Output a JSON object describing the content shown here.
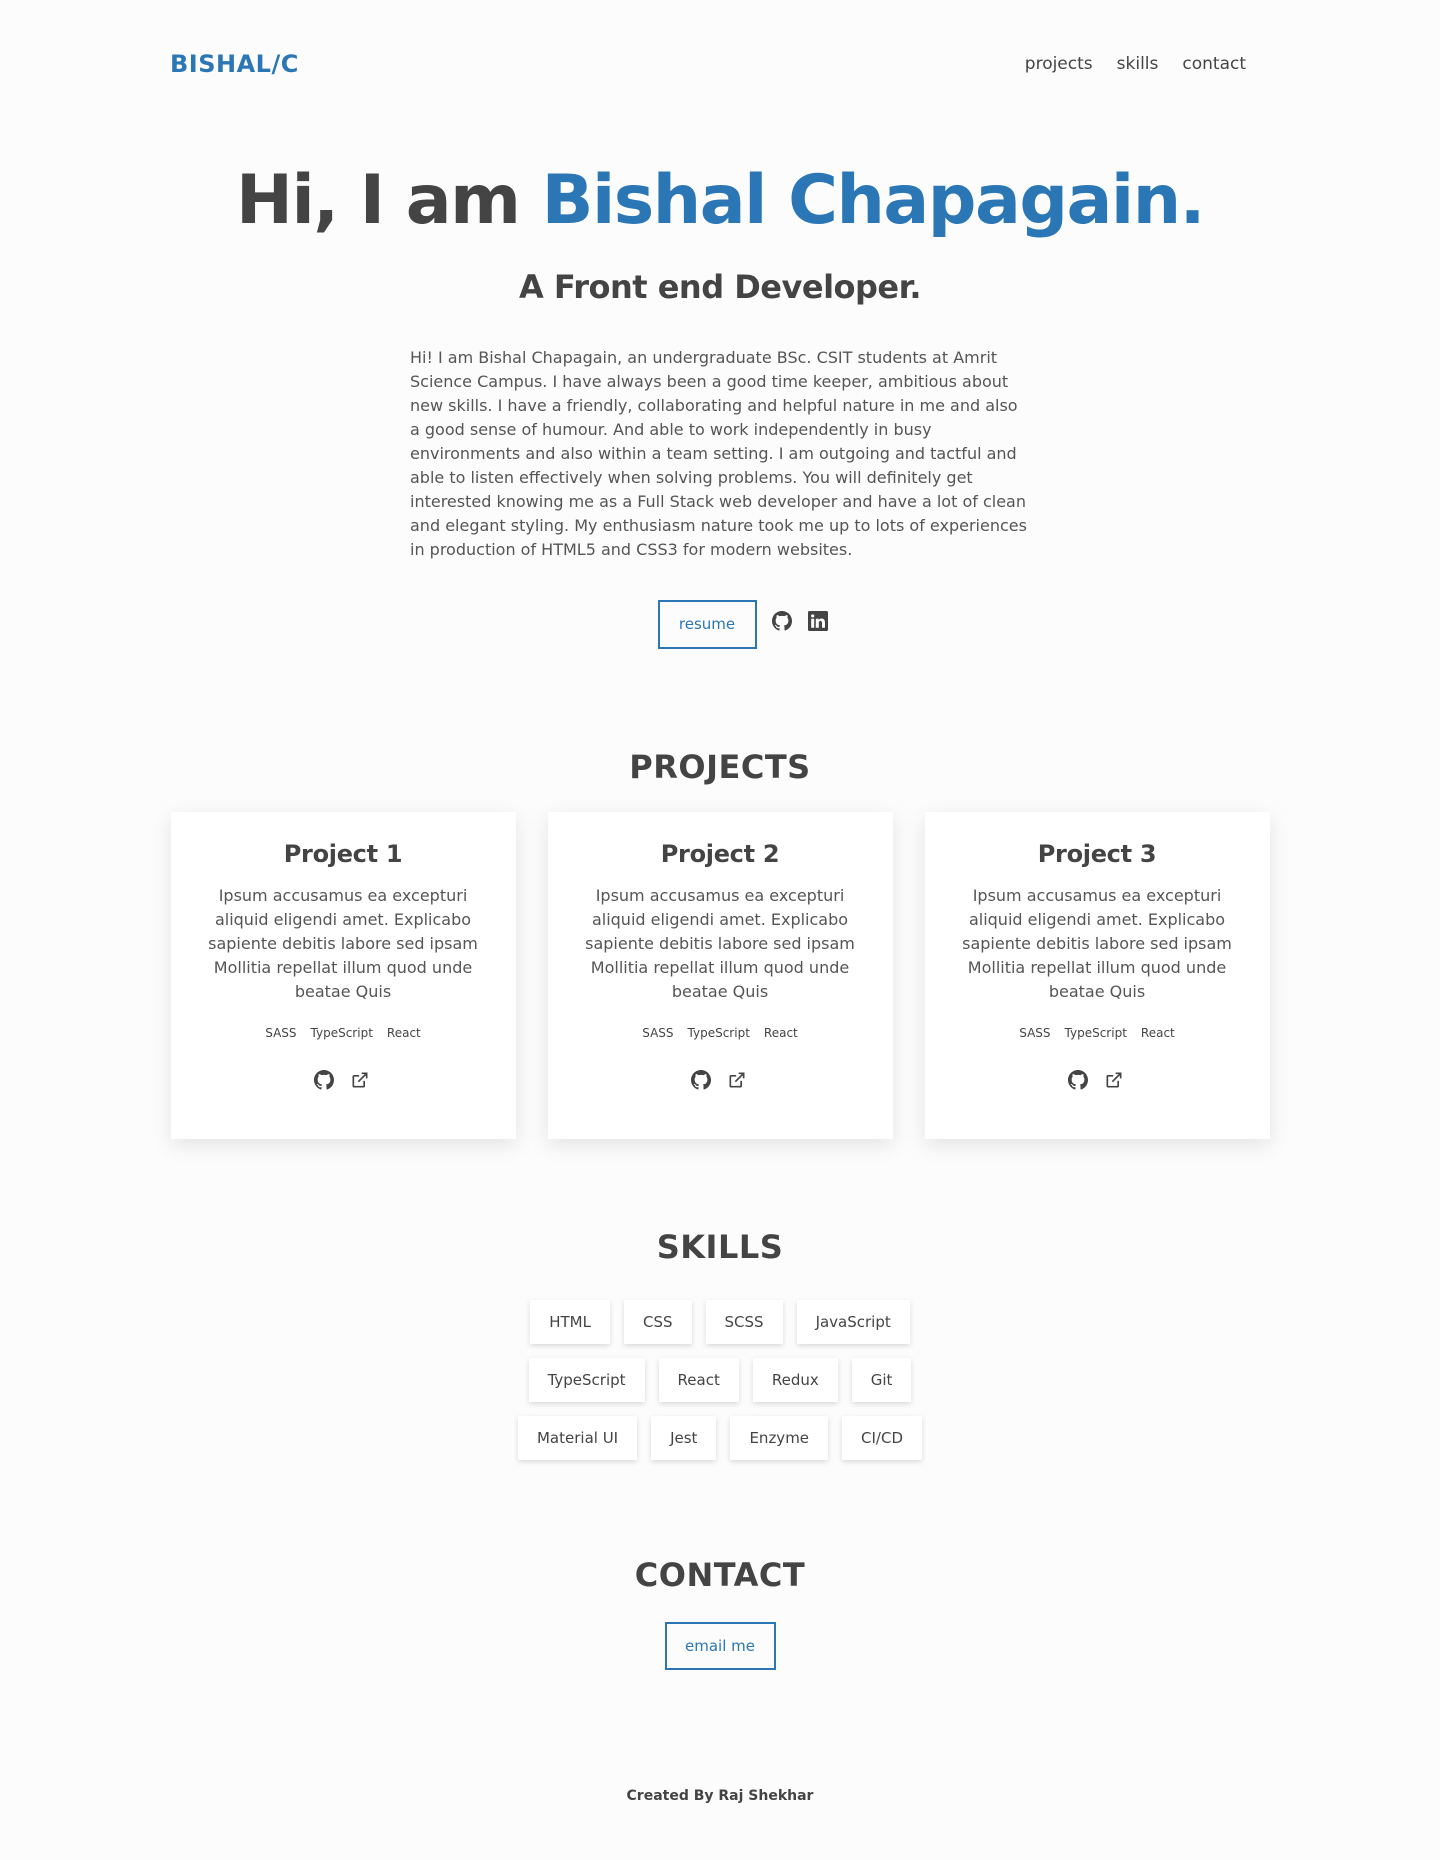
{
  "header": {
    "logo": "BISHAL/C",
    "nav": [
      "projects",
      "skills",
      "contact"
    ]
  },
  "hero": {
    "greeting": "Hi, I am ",
    "name": "Bishal Chapagain.",
    "subtitle": "A Front end Developer.",
    "about": "Hi! I am Bishal Chapagain, an undergraduate BSc. CSIT students at Amrit Science Campus. I have always been a good time keeper, ambitious about new skills. I have a friendly, collaborating and helpful nature in me and also a good sense of humour. And able to work independently in busy environments and also within a team setting. I am outgoing and tactful and able to listen effectively when solving problems. You will definitely get interested knowing me as a Full Stack web developer and have a lot of clean and elegant styling. My enthusiasm nature took me up to lots of experiences in production of HTML5 and CSS3 for modern websites.",
    "resume_label": "resume",
    "icons": [
      "github-icon",
      "linkedin-icon"
    ]
  },
  "projects": {
    "title": "PROJECTS",
    "items": [
      {
        "title": "Project 1",
        "description": "Ipsum accusamus ea excepturi aliquid eligendi amet. Explicabo sapiente debitis labore sed ipsam Mollitia repellat illum quod unde beatae Quis",
        "tags": [
          "SASS",
          "TypeScript",
          "React"
        ]
      },
      {
        "title": "Project 2",
        "description": "Ipsum accusamus ea excepturi aliquid eligendi amet. Explicabo sapiente debitis labore sed ipsam Mollitia repellat illum quod unde beatae Quis",
        "tags": [
          "SASS",
          "TypeScript",
          "React"
        ]
      },
      {
        "title": "Project 3",
        "description": "Ipsum accusamus ea excepturi aliquid eligendi amet. Explicabo sapiente debitis labore sed ipsam Mollitia repellat illum quod unde beatae Quis",
        "tags": [
          "SASS",
          "TypeScript",
          "React"
        ]
      }
    ],
    "link_icons": [
      "github-icon",
      "external-link-icon"
    ]
  },
  "skills": {
    "title": "SKILLS",
    "rows": [
      [
        "HTML",
        "CSS",
        "SCSS",
        "JavaScript"
      ],
      [
        "TypeScript",
        "React",
        "Redux",
        "Git"
      ],
      [
        "Material UI",
        "Jest",
        "Enzyme",
        "CI/CD"
      ]
    ]
  },
  "contact": {
    "title": "CONTACT",
    "email_label": "email me"
  },
  "footer": {
    "text": "Created By Raj Shekhar"
  },
  "colors": {
    "accent": "#2b77b5",
    "text": "#444444",
    "background": "#fcfcfc"
  }
}
